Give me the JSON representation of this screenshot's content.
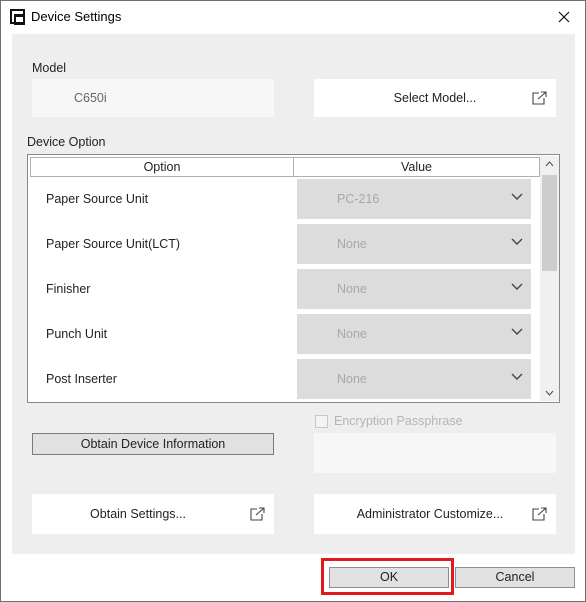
{
  "window": {
    "title": "Device Settings"
  },
  "model": {
    "label": "Model",
    "value": "C650i",
    "select_button": "Select Model..."
  },
  "device_option": {
    "label": "Device Option",
    "columns": [
      "Option",
      "Value"
    ],
    "rows": [
      {
        "option": "Paper Source Unit",
        "value": "PC-216"
      },
      {
        "option": "Paper Source Unit(LCT)",
        "value": "None"
      },
      {
        "option": "Finisher",
        "value": "None"
      },
      {
        "option": "Punch Unit",
        "value": "None"
      },
      {
        "option": "Post Inserter",
        "value": "None"
      }
    ]
  },
  "buttons": {
    "obtain_device_info": "Obtain Device Information",
    "obtain_settings": "Obtain Settings...",
    "admin_customize": "Administrator Customize...",
    "ok": "OK",
    "cancel": "Cancel"
  },
  "encryption": {
    "label": "Encryption Passphrase",
    "checked": false,
    "value": ""
  },
  "icons": {
    "app": "printer-settings-icon",
    "close": "close-icon",
    "external": "external-link-icon",
    "dropdown": "chevron-down-icon",
    "scroll_up": "scroll-up-icon",
    "scroll_down": "scroll-down-icon"
  },
  "colors": {
    "highlight": "#e01b1b",
    "panel": "#eeeeee",
    "disabled_text": "#a8a8a8"
  }
}
